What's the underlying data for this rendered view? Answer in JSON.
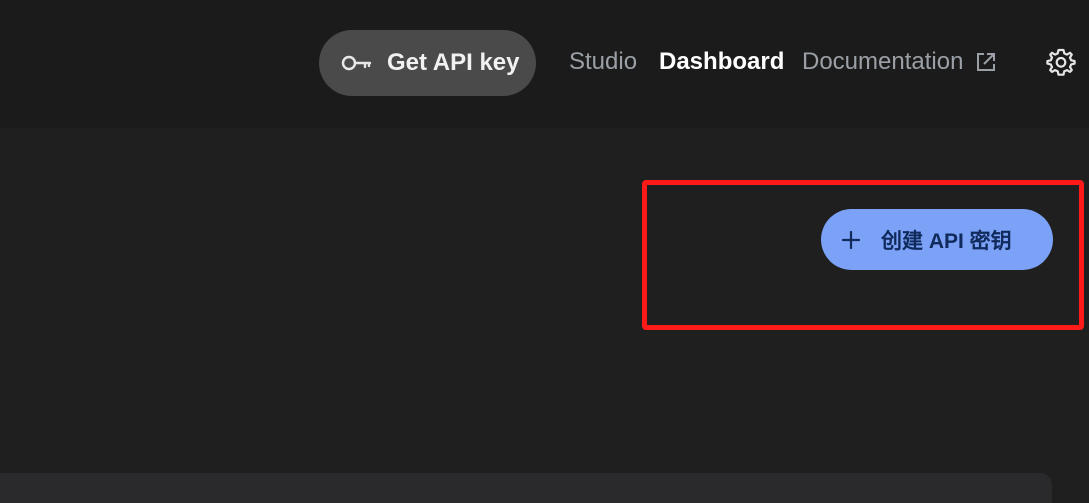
{
  "header": {
    "get_api_key_label": "Get API key",
    "get_api_key_icon": "key-icon",
    "nav": {
      "studio": "Studio",
      "dashboard": "Dashboard",
      "documentation": "Documentation",
      "documentation_icon": "external-link-icon"
    },
    "settings_icon": "gear-icon"
  },
  "main": {
    "create_api_key_label": "创建 API 密钥",
    "create_api_key_icon": "plus-icon"
  },
  "colors": {
    "background": "#1f1f1f",
    "topbar": "#1b1b1b",
    "primary_button": "#7ba2f7",
    "highlight": "#ff1a1a"
  }
}
